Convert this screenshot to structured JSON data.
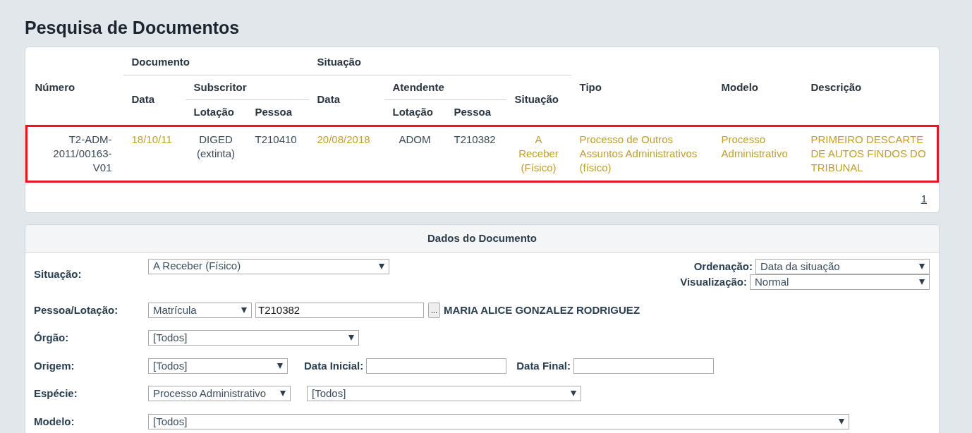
{
  "page_title": "Pesquisa de Documentos",
  "results": {
    "header_rows": [
      [
        {
          "label": "Número",
          "rowspan": 3
        },
        {
          "label": "Documento",
          "colspan": 3
        },
        {
          "label": "Situação",
          "colspan": 4
        },
        {
          "label": "Tipo",
          "rowspan": 3
        },
        {
          "label": "Modelo",
          "rowspan": 3
        },
        {
          "label": "Descrição",
          "rowspan": 3
        }
      ],
      [
        {
          "label": "Data",
          "rowspan": 2
        },
        {
          "label": "Subscritor",
          "colspan": 2
        },
        {
          "label": "Data",
          "rowspan": 2
        },
        {
          "label": "Atendente",
          "colspan": 2
        },
        {
          "label": "Situação",
          "rowspan": 2
        }
      ],
      [
        {
          "label": "Lotação"
        },
        {
          "label": "Pessoa"
        },
        {
          "label": "Lotação"
        },
        {
          "label": "Pessoa"
        }
      ]
    ],
    "rows": [
      {
        "highlighted": true,
        "cells": [
          {
            "kind": "text",
            "text": "T2-ADM-2011/00163-V01"
          },
          {
            "kind": "link",
            "text": "18/10/11"
          },
          {
            "kind": "text",
            "text": "DIGED (extinta)"
          },
          {
            "kind": "text",
            "text": "T210410"
          },
          {
            "kind": "link",
            "text": "20/08/2018"
          },
          {
            "kind": "text",
            "text": "ADOM"
          },
          {
            "kind": "text",
            "text": "T210382"
          },
          {
            "kind": "link",
            "text": "A Receber (Físico)"
          },
          {
            "kind": "link",
            "text": "Processo de Outros Assuntos Administrativos (físico)"
          },
          {
            "kind": "link",
            "text": "Processo Administrativo"
          },
          {
            "kind": "link",
            "text": "PRIMEIRO DESCARTE DE AUTOS FINDOS DO TRIBUNAL"
          }
        ]
      }
    ],
    "pages": [
      {
        "label": "1",
        "selected": true
      }
    ]
  },
  "form": {
    "title": "Dados do Documento",
    "situacao": {
      "label": "Situação:",
      "value": "A Receber (Físico)"
    },
    "ordenacao": {
      "label": "Ordenação:",
      "value": "Data da situação"
    },
    "visualizacao": {
      "label": "Visualização:",
      "value": "Normal"
    },
    "pessoa_lotacao": {
      "label": "Pessoa/Lotação:",
      "type_value": "Matrícula",
      "value": "T210382",
      "lookup_button": "...",
      "person_name": "MARIA ALICE GONZALEZ RODRIGUEZ"
    },
    "orgao": {
      "label": "Órgão:",
      "value": "[Todos]"
    },
    "origem": {
      "label": "Origem:",
      "value": "[Todos]"
    },
    "data_inicial": {
      "label": "Data Inicial:"
    },
    "data_final": {
      "label": "Data Final:"
    },
    "especie": {
      "label": "Espécie:",
      "value": "Processo Administrativo",
      "sub_value": "[Todos]"
    },
    "modelo": {
      "label": "Modelo:",
      "value": "[Todos]"
    }
  }
}
